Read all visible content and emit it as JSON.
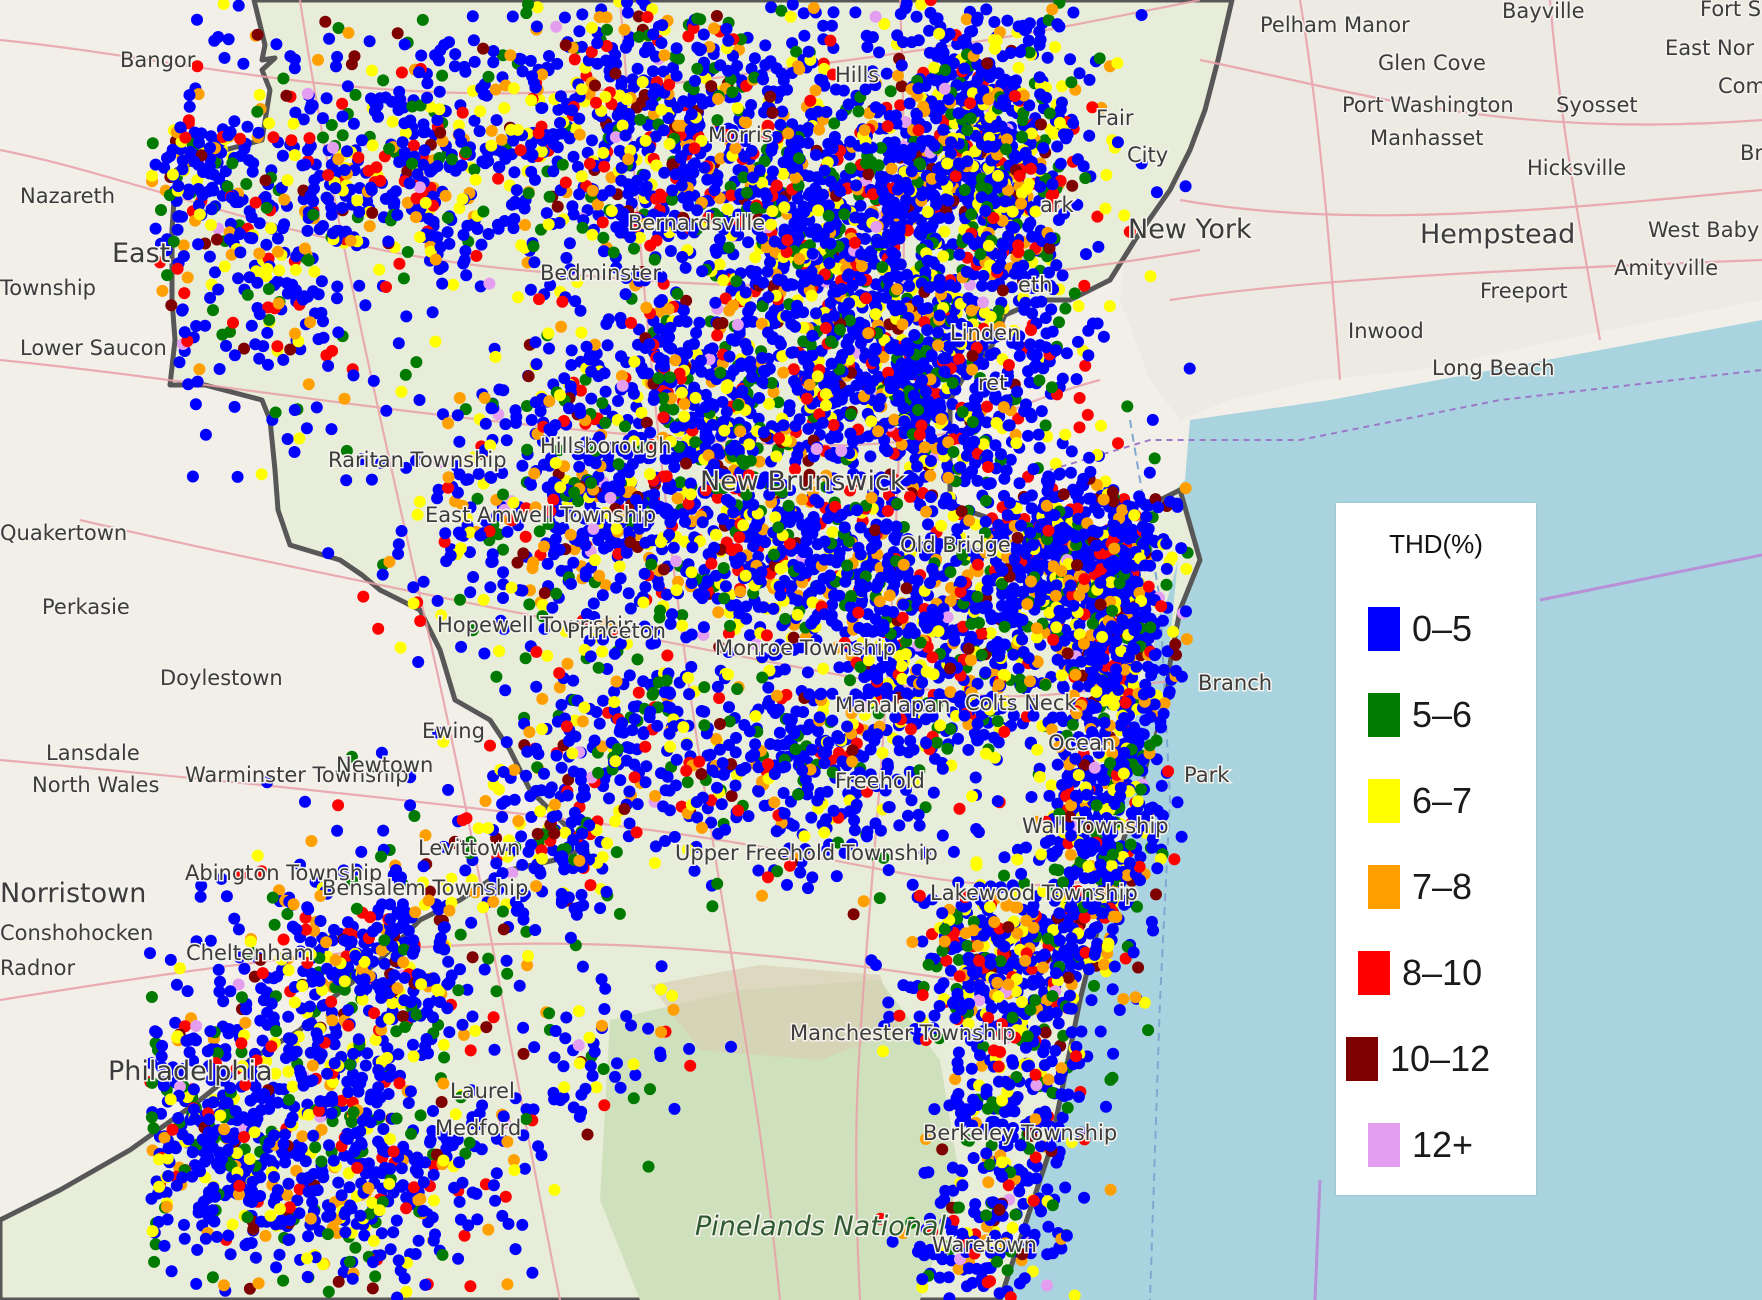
{
  "legend": {
    "title": "THD(%)",
    "items": [
      {
        "label": "0–5",
        "color": "#0000ff"
      },
      {
        "label": "5–6",
        "color": "#007a00"
      },
      {
        "label": "6–7",
        "color": "#ffff00"
      },
      {
        "label": "7–8",
        "color": "#ffa000"
      },
      {
        "label": "8–10",
        "color": "#ff0000"
      },
      {
        "label": "10–12",
        "color": "#7f0000"
      },
      {
        "label": "12+",
        "color": "#e49ef0"
      }
    ]
  },
  "places": [
    "Pelham Manor",
    "Bayville",
    "Fort S",
    "East Nor",
    "Com",
    "Glen Cove",
    "Port Washington",
    "Syosset",
    "Manhasset",
    "Br",
    "Hicksville",
    "Hempstead",
    "West Baby",
    "Amityville",
    "Freeport",
    "Inwood",
    "Long Beach",
    "New York",
    "Bangor",
    "Nazareth",
    "East",
    "Township",
    "Lower Saucon",
    "Bedminster",
    "Bernardsville",
    "Raritan Township",
    "Hillsborough",
    "New Brunswick",
    "East Amwell Township",
    "Quakertown",
    "Perkasie",
    "Hopewell Township",
    "Princeton",
    "Monroe Township",
    "Doylestown",
    "Lansdale",
    "North Wales",
    "Warminster Township",
    "Newtown",
    "Ewing",
    "Manalapan",
    "Colts Neck",
    "Ocean",
    "Freehold",
    "Wall Township",
    "Levittown",
    "Upper Freehold Township",
    "Abington Township",
    "Bensalem Township",
    "Norristown",
    "Conshohocken",
    "Cheltenham",
    "Radnor",
    "Lakewood Township",
    "Manchester Township",
    "Philadelphia",
    "Laurel",
    "Medford",
    "Berkeley Township",
    "Pinelands National",
    "Waretown",
    "Old Bridge",
    "Branch",
    "Park",
    "Hills",
    "Morris",
    "Fair",
    "City",
    "ark",
    "eth",
    "Linden",
    "ret"
  ]
}
